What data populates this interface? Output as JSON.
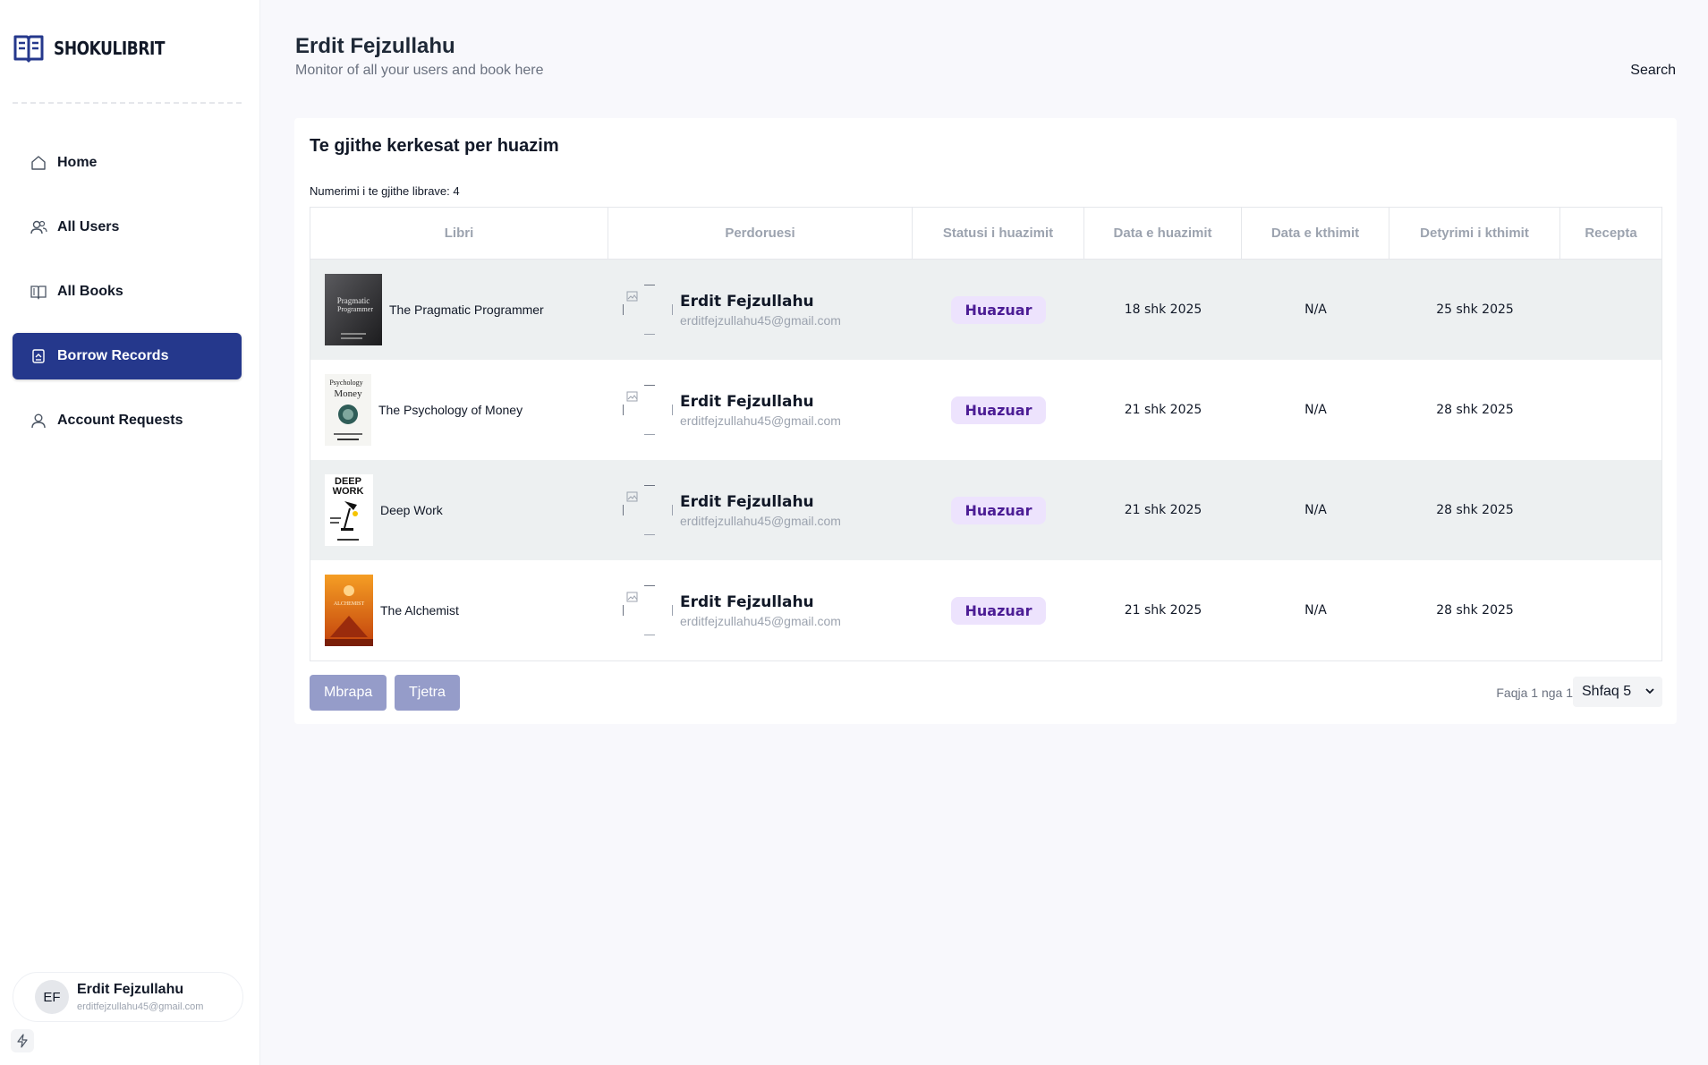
{
  "app": {
    "brand": "SHOKULIBRIT"
  },
  "sidebar": {
    "items": [
      {
        "label": "Home",
        "icon": "home-icon"
      },
      {
        "label": "All Users",
        "icon": "users-icon"
      },
      {
        "label": "All Books",
        "icon": "book-icon"
      },
      {
        "label": "Borrow Records",
        "icon": "borrow-icon",
        "active": true
      },
      {
        "label": "Account Requests",
        "icon": "user-icon"
      }
    ],
    "user": {
      "initials": "EF",
      "name": "Erdit Fejzullahu",
      "email": "erditfejzullahu45@gmail.com"
    }
  },
  "header": {
    "title": "Erdit Fejzullahu",
    "subtitle": "Monitor of all your users and book here",
    "search_label": "Search"
  },
  "main": {
    "card_title": "Te gjithe kerkesat per huazim",
    "count_text": "Numerimi i te gjithe librave: 4",
    "columns": [
      "Libri",
      "Perdoruesi",
      "Statusi i huazimit",
      "Data e huazimit",
      "Data e kthimit",
      "Detyrimi i kthimit",
      "Recepta"
    ],
    "rows": [
      {
        "book": "The Pragmatic Programmer",
        "user_name": "Erdit Fejzullahu",
        "user_email": "erditfejzullahu45@gmail.com",
        "status": "Huazuar",
        "borrow_date": "18 shk 2025",
        "return_date": "N/A",
        "due_date": "25 shk 2025",
        "receipt": ""
      },
      {
        "book": "The Psychology of Money",
        "user_name": "Erdit Fejzullahu",
        "user_email": "erditfejzullahu45@gmail.com",
        "status": "Huazuar",
        "borrow_date": "21 shk 2025",
        "return_date": "N/A",
        "due_date": "28 shk 2025",
        "receipt": ""
      },
      {
        "book": "Deep Work",
        "user_name": "Erdit Fejzullahu",
        "user_email": "erditfejzullahu45@gmail.com",
        "status": "Huazuar",
        "borrow_date": "21 shk 2025",
        "return_date": "N/A",
        "due_date": "28 shk 2025",
        "receipt": ""
      },
      {
        "book": "The Alchemist",
        "user_name": "Erdit Fejzullahu",
        "user_email": "erditfejzullahu45@gmail.com",
        "status": "Huazuar",
        "borrow_date": "21 shk 2025",
        "return_date": "N/A",
        "due_date": "28 shk 2025",
        "receipt": ""
      }
    ],
    "covers": {
      "pragmatic": {
        "line1": "Pragmatic",
        "line2": "Programmer"
      },
      "psychology": {
        "line1": "Psychology",
        "line2": "Money"
      },
      "deepwork": {
        "line1": "DEEP",
        "line2": "WORK"
      },
      "alchemist": {
        "line1": "ALCHEMIST"
      }
    },
    "pagination": {
      "prev": "Mbrapa",
      "next": "Tjetra",
      "page_info": "Faqja 1 nga 1",
      "page_size": "Shfaq 5"
    }
  },
  "colors": {
    "accent": "#25388c",
    "badge_bg": "#ede3fd",
    "badge_text": "#4c1d95",
    "row_shade": "#edf0f1",
    "pager_btn": "#959cc9"
  }
}
